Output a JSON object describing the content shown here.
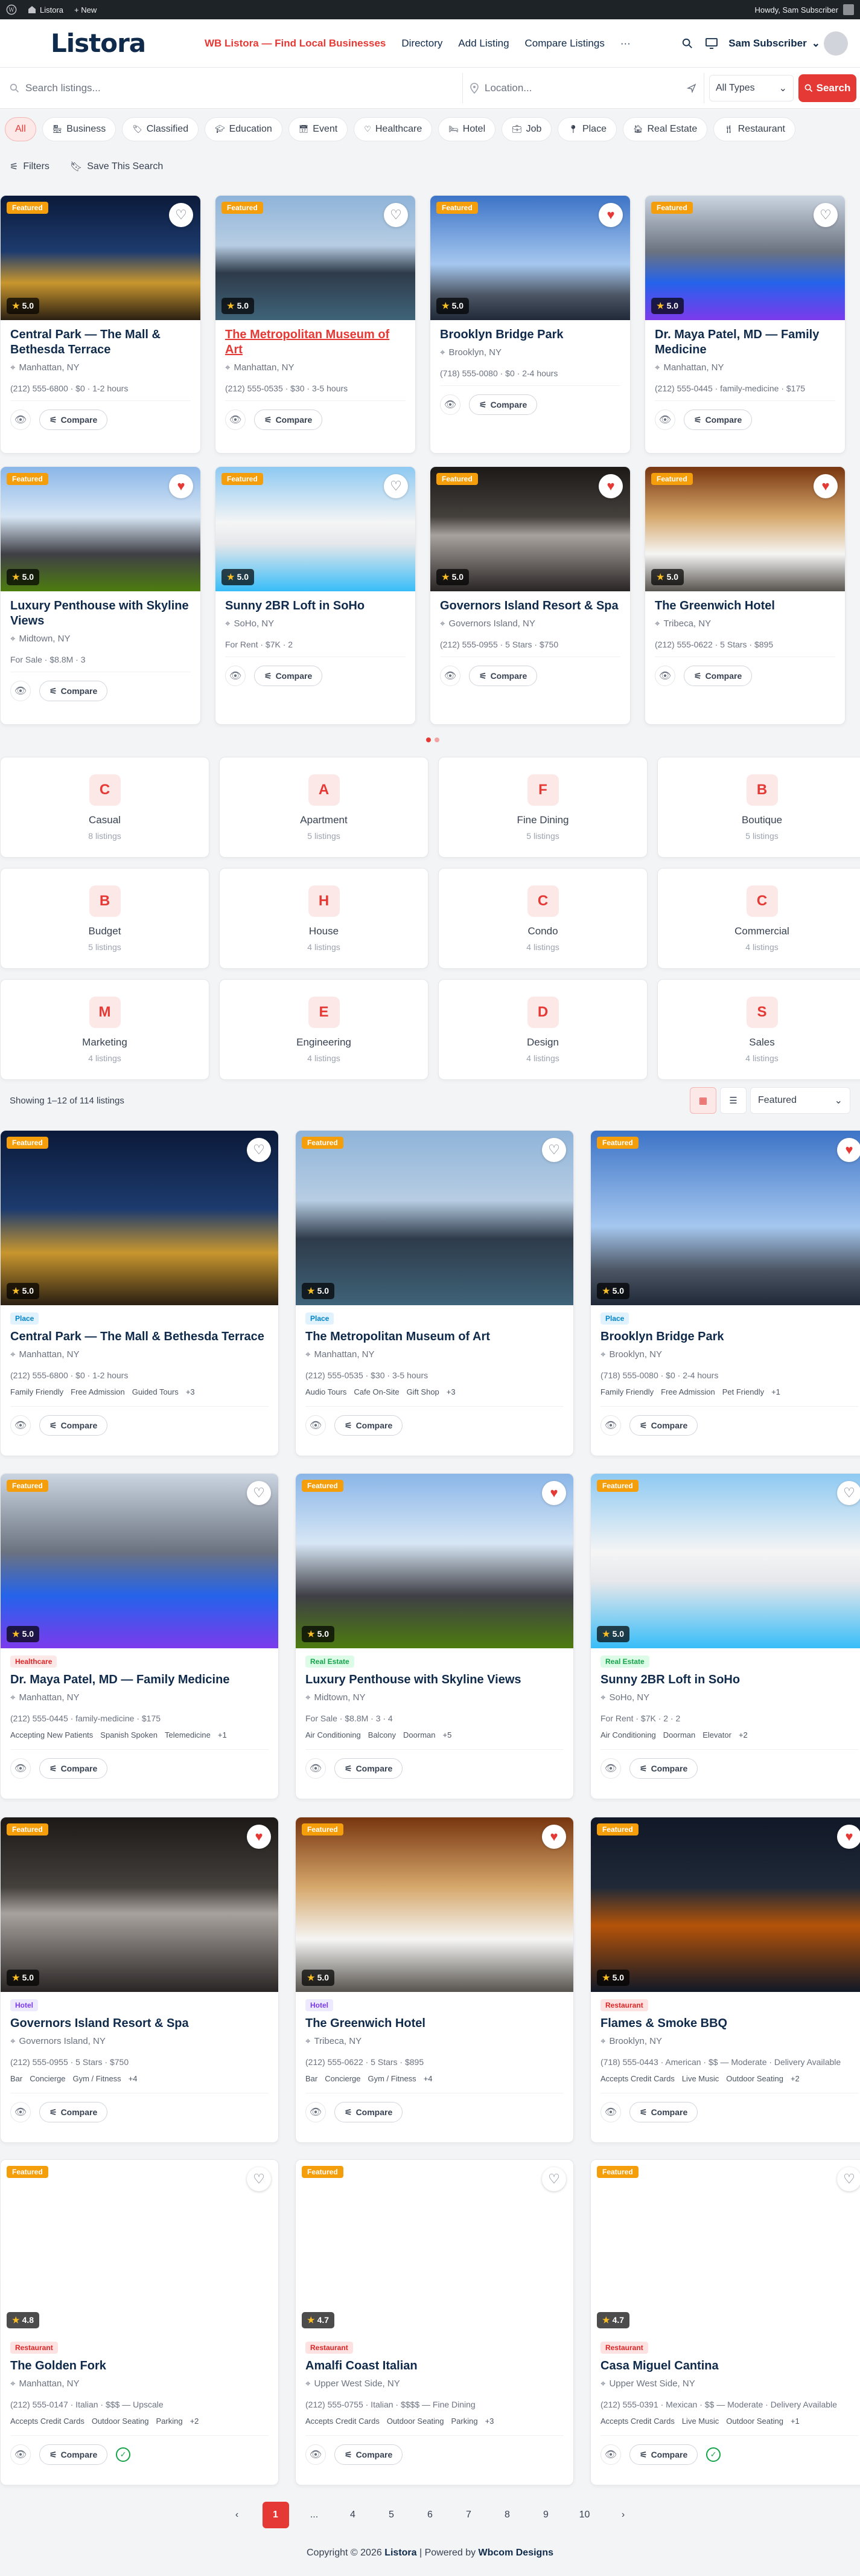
{
  "wpbar": {
    "site": "Listora",
    "new": "+ New",
    "howdy": "Howdy, Sam Subscriber"
  },
  "header": {
    "logo": "Listora",
    "nav": [
      "WB Listora — Find Local Businesses",
      "Directory",
      "Add Listing",
      "Compare Listings",
      "···"
    ],
    "user": "Sam Subscriber"
  },
  "search": {
    "placeholder": "Search listings...",
    "location_placeholder": "Location...",
    "type": "All Types",
    "button": "Search"
  },
  "chips": [
    "All",
    "Business",
    "Classified",
    "Education",
    "Event",
    "Healthcare",
    "Hotel",
    "Job",
    "Place",
    "Real Estate",
    "Restaurant"
  ],
  "tools": {
    "filters": "Filters",
    "save": "Save This Search"
  },
  "common": {
    "compare": "Compare"
  },
  "carousel": [
    {
      "title": "Central Park — The Mall & Bethesda Terrace",
      "loc": "Manhattan, NY",
      "meta": "(212) 555-6800 · $0 · 1-2 hours",
      "rating": "5.0",
      "fav": false
    },
    {
      "title": "The Metropolitan Museum of Art",
      "loc": "Manhattan, NY",
      "meta": "(212) 555-0535 · $30 · 3-5 hours",
      "rating": "5.0",
      "fav": false
    },
    {
      "title": "Brooklyn Bridge Park",
      "loc": "Brooklyn, NY",
      "meta": "(718) 555-0080 · $0 · 2-4 hours",
      "rating": "5.0",
      "fav": true
    },
    {
      "title": "Dr. Maya Patel, MD — Family Medicine",
      "loc": "Manhattan, NY",
      "meta": "(212) 555-0445 · family-medicine · $175",
      "rating": "5.0",
      "fav": false
    },
    {
      "title": "Luxury Penthouse with Skyline Views",
      "loc": "Midtown, NY",
      "meta": "For Sale · $8.8M · 3",
      "rating": "5.0",
      "fav": true
    },
    {
      "title": "Sunny 2BR Loft in SoHo",
      "loc": "SoHo, NY",
      "meta": "For Rent · $7K · 2",
      "rating": "5.0",
      "fav": false
    },
    {
      "title": "Governors Island Resort & Spa",
      "loc": "Governors Island, NY",
      "meta": "(212) 555-0955 · 5 Stars · $750",
      "rating": "5.0",
      "fav": true
    },
    {
      "title": "The Greenwich Hotel",
      "loc": "Tribeca, NY",
      "meta": "(212) 555-0622 · 5 Stars · $895",
      "rating": "5.0",
      "fav": true
    }
  ],
  "featured_label": "Featured",
  "tax": [
    {
      "l": "C",
      "n": "Casual",
      "c": "8 listings"
    },
    {
      "l": "A",
      "n": "Apartment",
      "c": "5 listings"
    },
    {
      "l": "F",
      "n": "Fine Dining",
      "c": "5 listings"
    },
    {
      "l": "B",
      "n": "Boutique",
      "c": "5 listings"
    },
    {
      "l": "B",
      "n": "Budget",
      "c": "5 listings"
    },
    {
      "l": "H",
      "n": "House",
      "c": "4 listings"
    },
    {
      "l": "C",
      "n": "Condo",
      "c": "4 listings"
    },
    {
      "l": "C",
      "n": "Commercial",
      "c": "4 listings"
    },
    {
      "l": "M",
      "n": "Marketing",
      "c": "4 listings"
    },
    {
      "l": "E",
      "n": "Engineering",
      "c": "4 listings"
    },
    {
      "l": "D",
      "n": "Design",
      "c": "4 listings"
    },
    {
      "l": "S",
      "n": "Sales",
      "c": "4 listings"
    }
  ],
  "results": {
    "showing": "Showing 1–12 of 114 listings",
    "sort": "Featured"
  },
  "grid": [
    {
      "cat": "Place",
      "ck": "place",
      "title": "Central Park — The Mall & Bethesda Terrace",
      "loc": "Manhattan, NY",
      "meta": "(212) 555-6800 · $0 · 1-2 hours",
      "tags": [
        "Family Friendly",
        "Free Admission",
        "Guided Tours",
        "+3"
      ],
      "rating": "5.0",
      "fav": false,
      "feat": true,
      "chk": false
    },
    {
      "cat": "Place",
      "ck": "place",
      "title": "The Metropolitan Museum of Art",
      "loc": "Manhattan, NY",
      "meta": "(212) 555-0535 · $30 · 3-5 hours",
      "tags": [
        "Audio Tours",
        "Cafe On-Site",
        "Gift Shop",
        "+3"
      ],
      "rating": "5.0",
      "fav": false,
      "feat": true,
      "chk": false
    },
    {
      "cat": "Place",
      "ck": "place",
      "title": "Brooklyn Bridge Park",
      "loc": "Brooklyn, NY",
      "meta": "(718) 555-0080 · $0 · 2-4 hours",
      "tags": [
        "Family Friendly",
        "Free Admission",
        "Pet Friendly",
        "+1"
      ],
      "rating": "5.0",
      "fav": true,
      "feat": true,
      "chk": false
    },
    {
      "cat": "Healthcare",
      "ck": "health",
      "title": "Dr. Maya Patel, MD — Family Medicine",
      "loc": "Manhattan, NY",
      "meta": "(212) 555-0445 · family-medicine · $175",
      "tags": [
        "Accepting New Patients",
        "Spanish Spoken",
        "Telemedicine",
        "+1"
      ],
      "rating": "5.0",
      "fav": false,
      "feat": true,
      "chk": false
    },
    {
      "cat": "Real Estate",
      "ck": "re",
      "title": "Luxury Penthouse with Skyline Views",
      "loc": "Midtown, NY",
      "meta": "For Sale · $8.8M · 3 · 4",
      "tags": [
        "Air Conditioning",
        "Balcony",
        "Doorman",
        "+5"
      ],
      "rating": "5.0",
      "fav": true,
      "feat": true,
      "chk": false
    },
    {
      "cat": "Real Estate",
      "ck": "re",
      "title": "Sunny 2BR Loft in SoHo",
      "loc": "SoHo, NY",
      "meta": "For Rent · $7K · 2 · 2",
      "tags": [
        "Air Conditioning",
        "Doorman",
        "Elevator",
        "+2"
      ],
      "rating": "5.0",
      "fav": false,
      "feat": true,
      "chk": false
    },
    {
      "cat": "Hotel",
      "ck": "hotel",
      "title": "Governors Island Resort & Spa",
      "loc": "Governors Island, NY",
      "meta": "(212) 555-0955 · 5 Stars · $750",
      "tags": [
        "Bar",
        "Concierge",
        "Gym / Fitness",
        "+4"
      ],
      "rating": "5.0",
      "fav": true,
      "feat": true,
      "chk": false
    },
    {
      "cat": "Hotel",
      "ck": "hotel",
      "title": "The Greenwich Hotel",
      "loc": "Tribeca, NY",
      "meta": "(212) 555-0622 · 5 Stars · $895",
      "tags": [
        "Bar",
        "Concierge",
        "Gym / Fitness",
        "+4"
      ],
      "rating": "5.0",
      "fav": true,
      "feat": true,
      "chk": false
    },
    {
      "cat": "Restaurant",
      "ck": "rest",
      "title": "Flames & Smoke BBQ",
      "loc": "Brooklyn, NY",
      "meta": "(718) 555-0443 · American · $$ — Moderate · Delivery Available",
      "tags": [
        "Accepts Credit Cards",
        "Live Music",
        "Outdoor Seating",
        "+2"
      ],
      "rating": "5.0",
      "fav": true,
      "feat": true,
      "chk": false
    },
    {
      "cat": "Restaurant",
      "ck": "rest",
      "title": "The Golden Fork",
      "loc": "Manhattan, NY",
      "meta": "(212) 555-0147 · Italian · $$$ — Upscale",
      "tags": [
        "Accepts Credit Cards",
        "Outdoor Seating",
        "Parking",
        "+2"
      ],
      "rating": "4.8",
      "fav": false,
      "feat": true,
      "chk": true
    },
    {
      "cat": "Restaurant",
      "ck": "rest",
      "title": "Amalfi Coast Italian",
      "loc": "Upper West Side, NY",
      "meta": "(212) 555-0755 · Italian · $$$$ — Fine Dining",
      "tags": [
        "Accepts Credit Cards",
        "Outdoor Seating",
        "Parking",
        "+3"
      ],
      "rating": "4.7",
      "fav": false,
      "feat": true,
      "chk": false
    },
    {
      "cat": "Restaurant",
      "ck": "rest",
      "title": "Casa Miguel Cantina",
      "loc": "Upper West Side, NY",
      "meta": "(212) 555-0391 · Mexican · $$ — Moderate · Delivery Available",
      "tags": [
        "Accepts Credit Cards",
        "Live Music",
        "Outdoor Seating",
        "+1"
      ],
      "rating": "4.7",
      "fav": false,
      "feat": true,
      "chk": true
    }
  ],
  "pager": [
    "‹",
    "1",
    "...",
    "4",
    "5",
    "6",
    "7",
    "8",
    "9",
    "10",
    "›"
  ],
  "footer": {
    "pre": "Copyright © 2026 ",
    "brand": "Listora",
    "mid": " | Powered by ",
    "by": "Wbcom Designs"
  }
}
